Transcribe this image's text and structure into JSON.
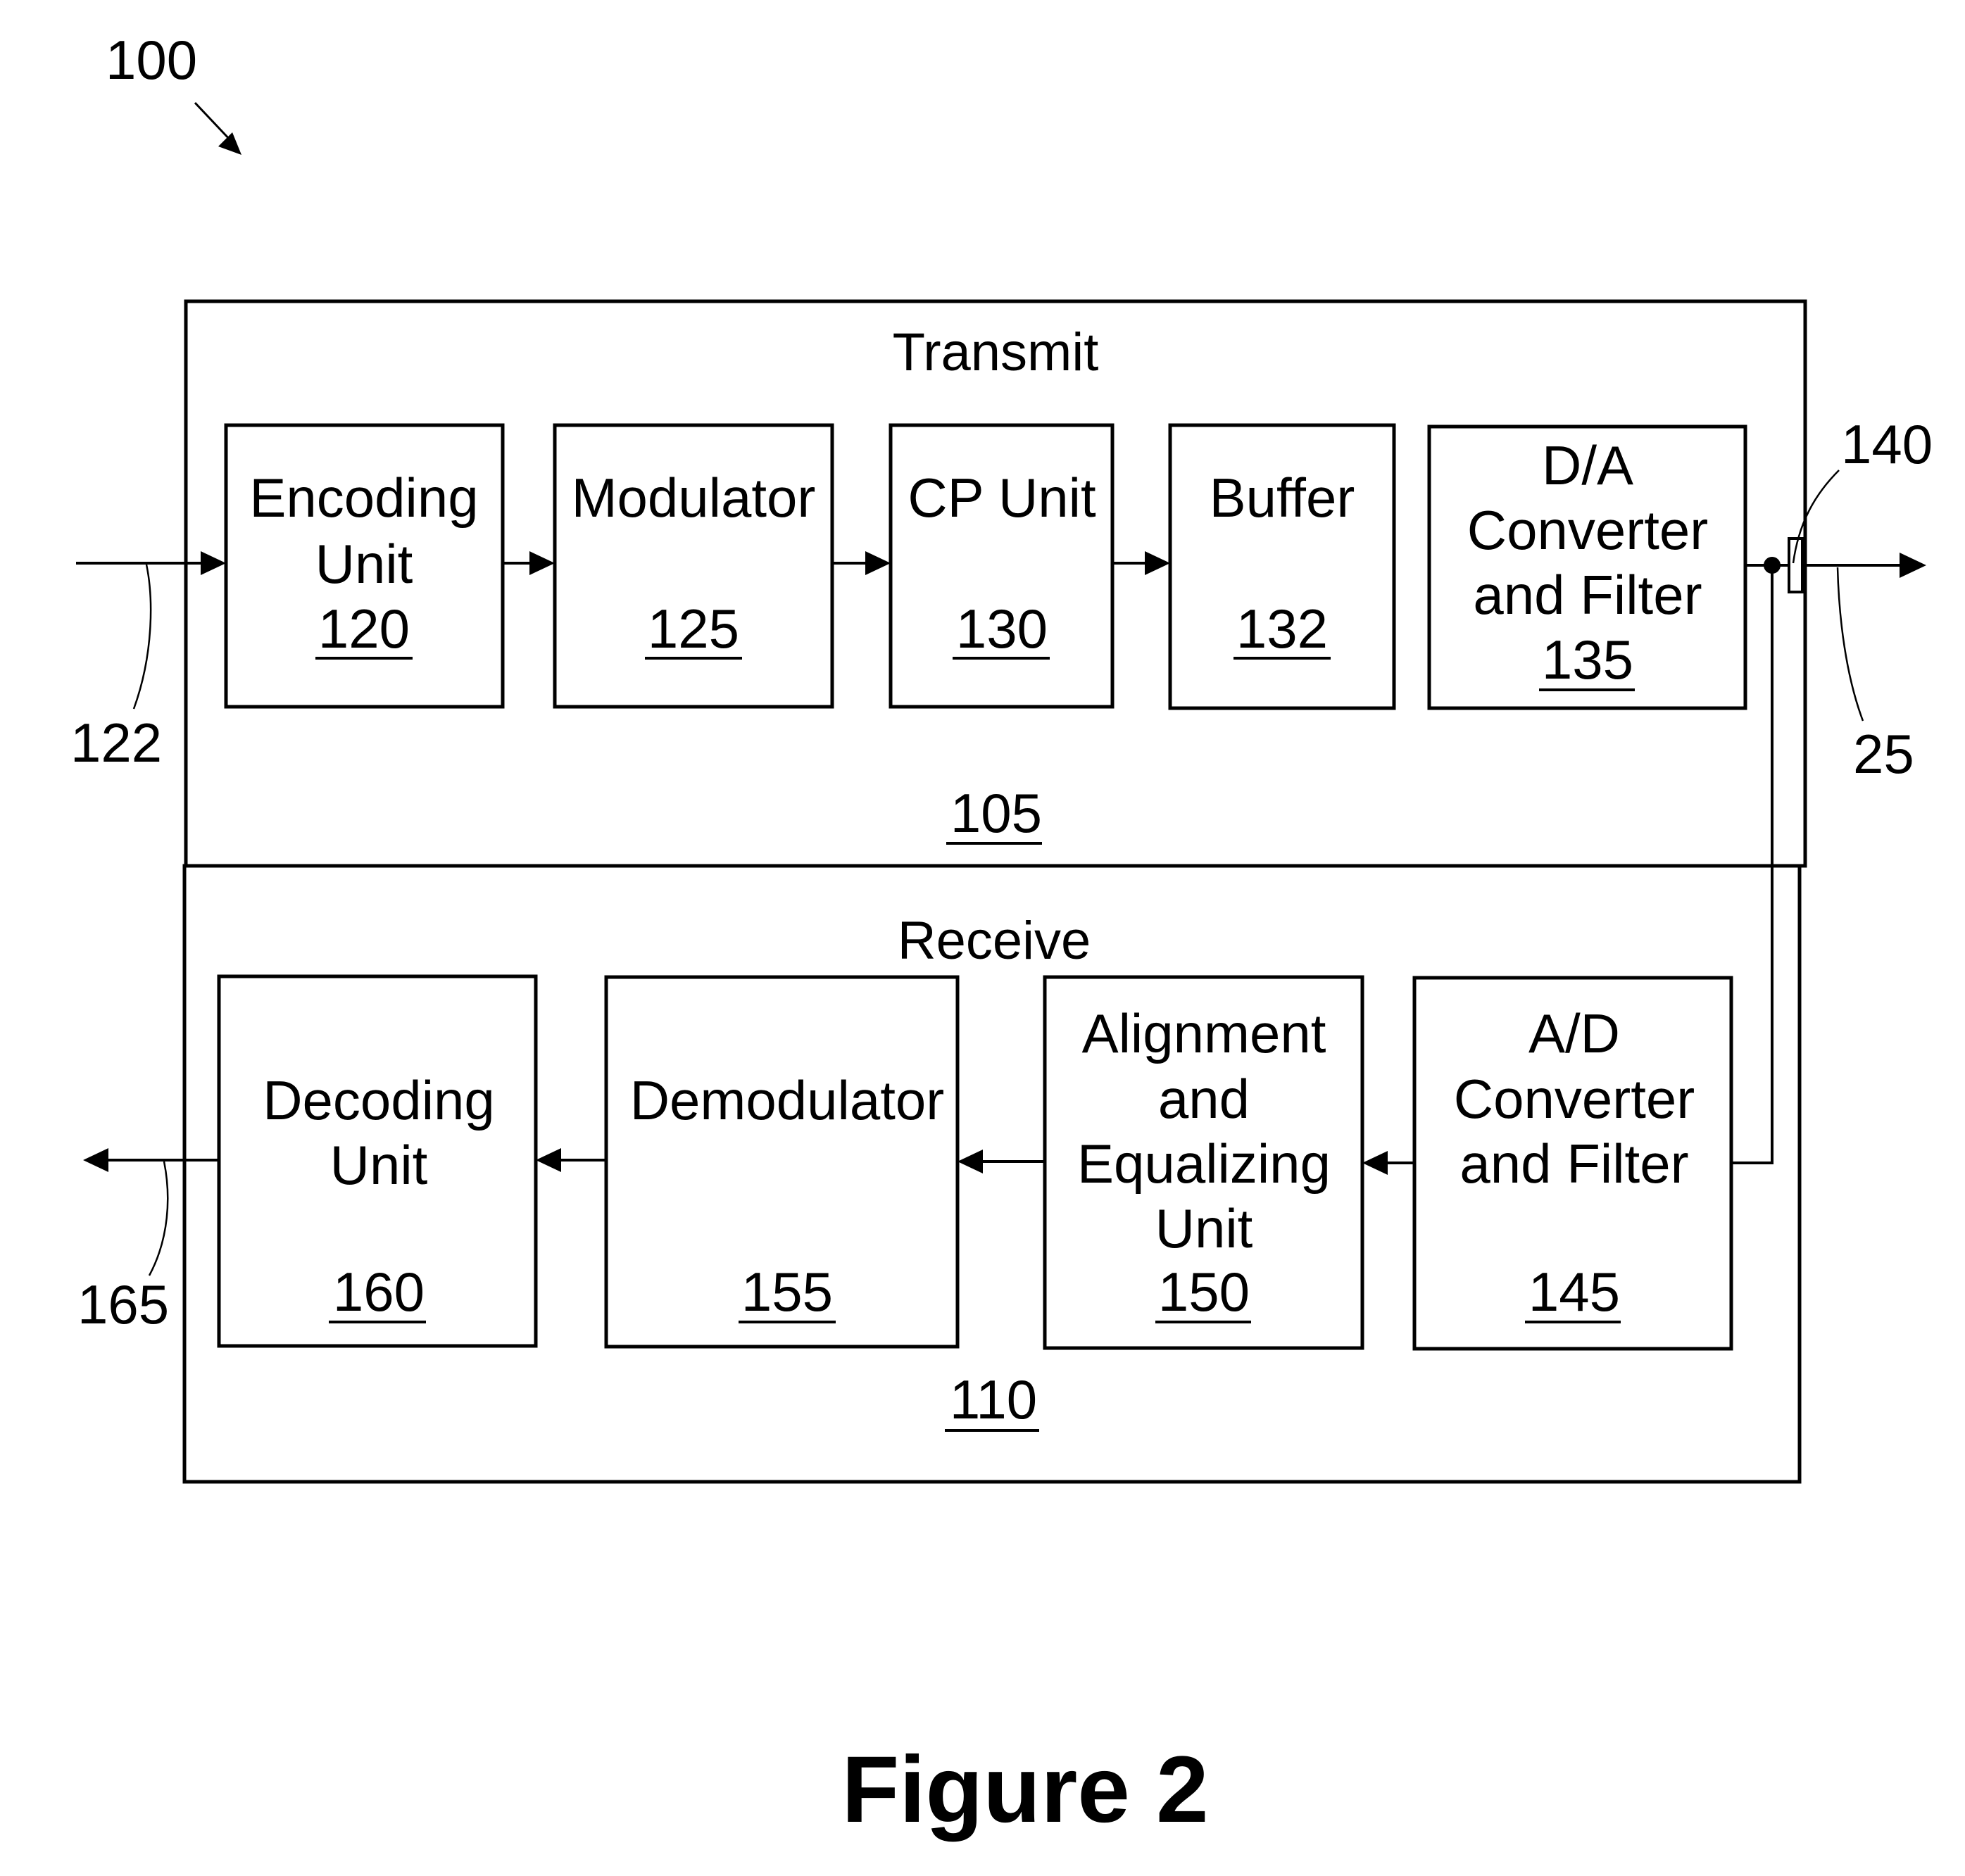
{
  "figure": {
    "caption": "Figure 2",
    "system_ref": "100"
  },
  "transmit": {
    "title": "Transmit",
    "ref": "105",
    "blocks": [
      {
        "lines": [
          "Encoding",
          "Unit"
        ],
        "ref": "120"
      },
      {
        "lines": [
          "Modulator"
        ],
        "ref": "125"
      },
      {
        "lines": [
          "CP Unit"
        ],
        "ref": "130"
      },
      {
        "lines": [
          "Buffer"
        ],
        "ref": "132"
      },
      {
        "lines": [
          "D/A",
          "Converter",
          "and Filter"
        ],
        "ref": "135"
      }
    ]
  },
  "receive": {
    "title": "Receive",
    "ref": "110",
    "blocks": [
      {
        "lines": [
          "Decoding",
          "Unit"
        ],
        "ref": "160"
      },
      {
        "lines": [
          "Demodulator"
        ],
        "ref": "155"
      },
      {
        "lines": [
          "Alignment",
          "and",
          "Equalizing",
          "Unit"
        ],
        "ref": "150"
      },
      {
        "lines": [
          "A/D",
          "Converter",
          "and Filter"
        ],
        "ref": "145"
      }
    ]
  },
  "signals": {
    "input_ref": "122",
    "output_ref": "165",
    "coupler_ref": "140",
    "line_ref": "25"
  }
}
